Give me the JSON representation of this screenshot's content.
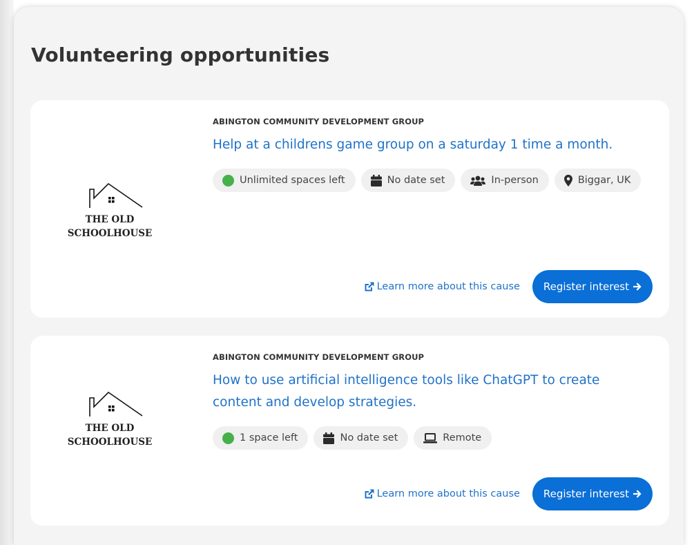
{
  "page_title": "Volunteering opportunities",
  "colors": {
    "link": "#1f72c9",
    "button": "#0a6fd6",
    "availability_dot": "#46b14a",
    "pill_bg": "#f0f0f0"
  },
  "opportunities": [
    {
      "org": "ABINGTON COMMUNITY DEVELOPMENT GROUP",
      "title": "Help at a childrens game group on a saturday 1 time a month.",
      "logo": {
        "line1": "THE OLD",
        "line2": "SCHOOLHOUSE"
      },
      "spaces": "Unlimited spaces left",
      "date": "No date set",
      "mode": "In-person",
      "mode_icon": "users-icon",
      "location": "Biggar, UK",
      "learn_more": "Learn more about this cause",
      "register": "Register interest"
    },
    {
      "org": "ABINGTON COMMUNITY DEVELOPMENT GROUP",
      "title": "How to use artificial intelligence tools like ChatGPT to create content and develop strategies.",
      "logo": {
        "line1": "THE OLD",
        "line2": "SCHOOLHOUSE"
      },
      "spaces": "1 space left",
      "date": "No date set",
      "mode": "Remote",
      "mode_icon": "laptop-icon",
      "learn_more": "Learn more about this cause",
      "register": "Register interest"
    }
  ]
}
